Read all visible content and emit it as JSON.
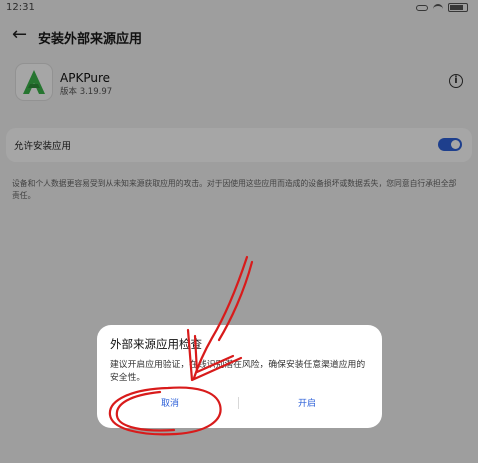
{
  "status_bar": {
    "time": "12:31"
  },
  "header": {
    "title": "安装外部来源应用"
  },
  "app": {
    "name": "APKPure",
    "version": "版本 3.19.97",
    "icon": "apkpure-logo-icon"
  },
  "permission": {
    "label": "允许安装应用",
    "enabled": true
  },
  "warning": {
    "text": "设备和个人数据更容易受到从未知来源获取应用的攻击。对于因使用这些应用而造成的设备损坏或数据丢失，您同意自行承担全部责任。"
  },
  "dialog": {
    "title": "外部来源应用检查",
    "body": "建议开启应用验证，在线识别潜在风险，确保安装任意渠道应用的安全性。",
    "cancel_label": "取消",
    "confirm_label": "开启"
  },
  "colors": {
    "accent": "#2f62d9",
    "annotation": "#d81b1b",
    "app_logo": "#3bb44a"
  }
}
